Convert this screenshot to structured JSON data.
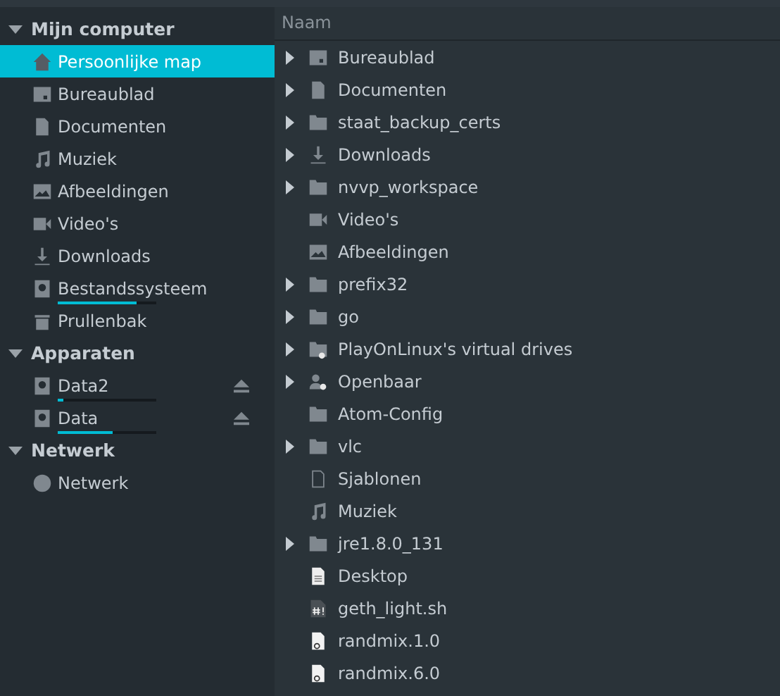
{
  "sidebar": {
    "sections": [
      {
        "title": "Mijn computer",
        "expanded": true,
        "items": [
          {
            "label": "Persoonlijke map",
            "kind": "home",
            "selected": true
          },
          {
            "label": "Bureaublad",
            "kind": "desktop",
            "selected": false
          },
          {
            "label": "Documenten",
            "kind": "document",
            "selected": false
          },
          {
            "label": "Muziek",
            "kind": "music",
            "selected": false
          },
          {
            "label": "Afbeeldingen",
            "kind": "picture",
            "selected": false
          },
          {
            "label": "Video's",
            "kind": "video",
            "selected": false
          },
          {
            "label": "Downloads",
            "kind": "download",
            "selected": false
          },
          {
            "label": "Bestandssysteem",
            "kind": "drive",
            "selected": false,
            "level": 0.8
          },
          {
            "label": "Prullenbak",
            "kind": "trash",
            "selected": false
          }
        ]
      },
      {
        "title": "Apparaten",
        "expanded": true,
        "items": [
          {
            "label": "Data2",
            "kind": "drive",
            "selected": false,
            "level": 0.05,
            "ejectable": true
          },
          {
            "label": "Data",
            "kind": "drive",
            "selected": false,
            "level": 0.55,
            "ejectable": true
          }
        ]
      },
      {
        "title": "Netwerk",
        "expanded": true,
        "items": [
          {
            "label": "Netwerk",
            "kind": "network",
            "selected": false
          }
        ]
      }
    ]
  },
  "list": {
    "column": "Naam",
    "rows": [
      {
        "name": "Bureaublad",
        "kind": "desktop",
        "expandable": true
      },
      {
        "name": "Documenten",
        "kind": "document",
        "expandable": true
      },
      {
        "name": "staat_backup_certs",
        "kind": "folder",
        "expandable": true
      },
      {
        "name": "Downloads",
        "kind": "download",
        "expandable": true
      },
      {
        "name": "nvvp_workspace",
        "kind": "folder",
        "expandable": true
      },
      {
        "name": "Video's",
        "kind": "video",
        "expandable": false
      },
      {
        "name": "Afbeeldingen",
        "kind": "picture",
        "expandable": false
      },
      {
        "name": "prefix32",
        "kind": "folder",
        "expandable": true
      },
      {
        "name": "go",
        "kind": "folder",
        "expandable": true
      },
      {
        "name": "PlayOnLinux's virtual drives",
        "kind": "link-folder",
        "expandable": true
      },
      {
        "name": "Openbaar",
        "kind": "shared",
        "expandable": true
      },
      {
        "name": "Atom-Config",
        "kind": "folder",
        "expandable": false
      },
      {
        "name": "vlc",
        "kind": "folder",
        "expandable": true
      },
      {
        "name": "Sjablonen",
        "kind": "template",
        "expandable": false
      },
      {
        "name": "Muziek",
        "kind": "music",
        "expandable": false
      },
      {
        "name": "jre1.8.0_131",
        "kind": "folder",
        "expandable": true
      },
      {
        "name": "Desktop",
        "kind": "text",
        "expandable": false
      },
      {
        "name": "geth_light.sh",
        "kind": "script",
        "expandable": false
      },
      {
        "name": "randmix.1.0",
        "kind": "link-file",
        "expandable": false
      },
      {
        "name": "randmix.6.0",
        "kind": "link-file",
        "expandable": false
      }
    ]
  }
}
